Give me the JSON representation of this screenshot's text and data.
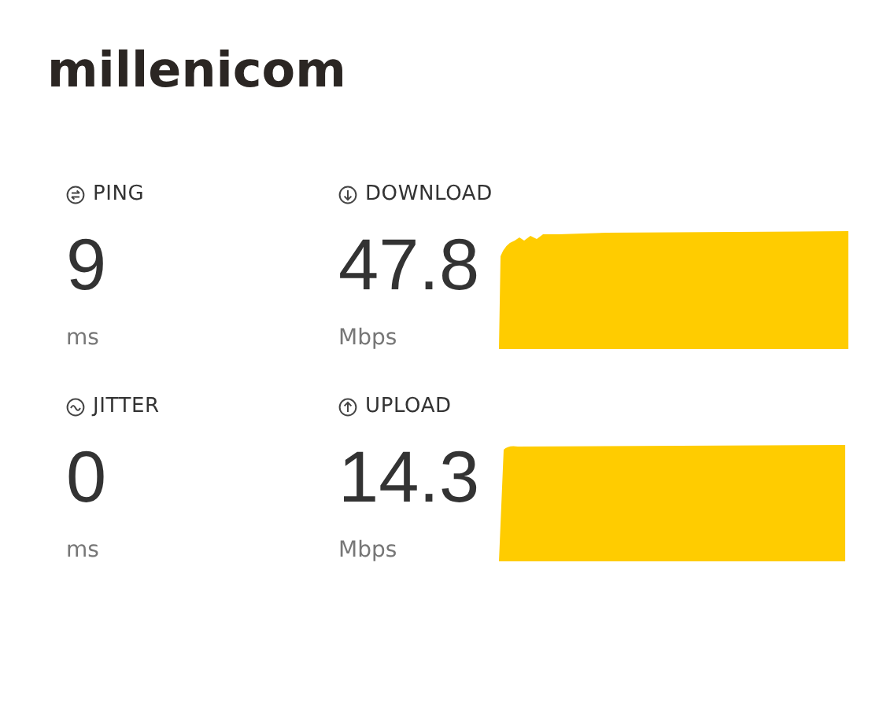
{
  "logo": "millenicom",
  "metrics": [
    {
      "kind": "small",
      "label": "PING",
      "value": "9",
      "unit": "ms"
    },
    {
      "kind": "graph",
      "label": "DOWNLOAD",
      "value": "47.8",
      "unit": "Mbps"
    },
    {
      "kind": "small",
      "label": "JITTER",
      "value": "0",
      "unit": "ms"
    },
    {
      "kind": "graph",
      "label": "UPLOAD",
      "value": "14.3",
      "unit": "Mbps"
    }
  ]
}
